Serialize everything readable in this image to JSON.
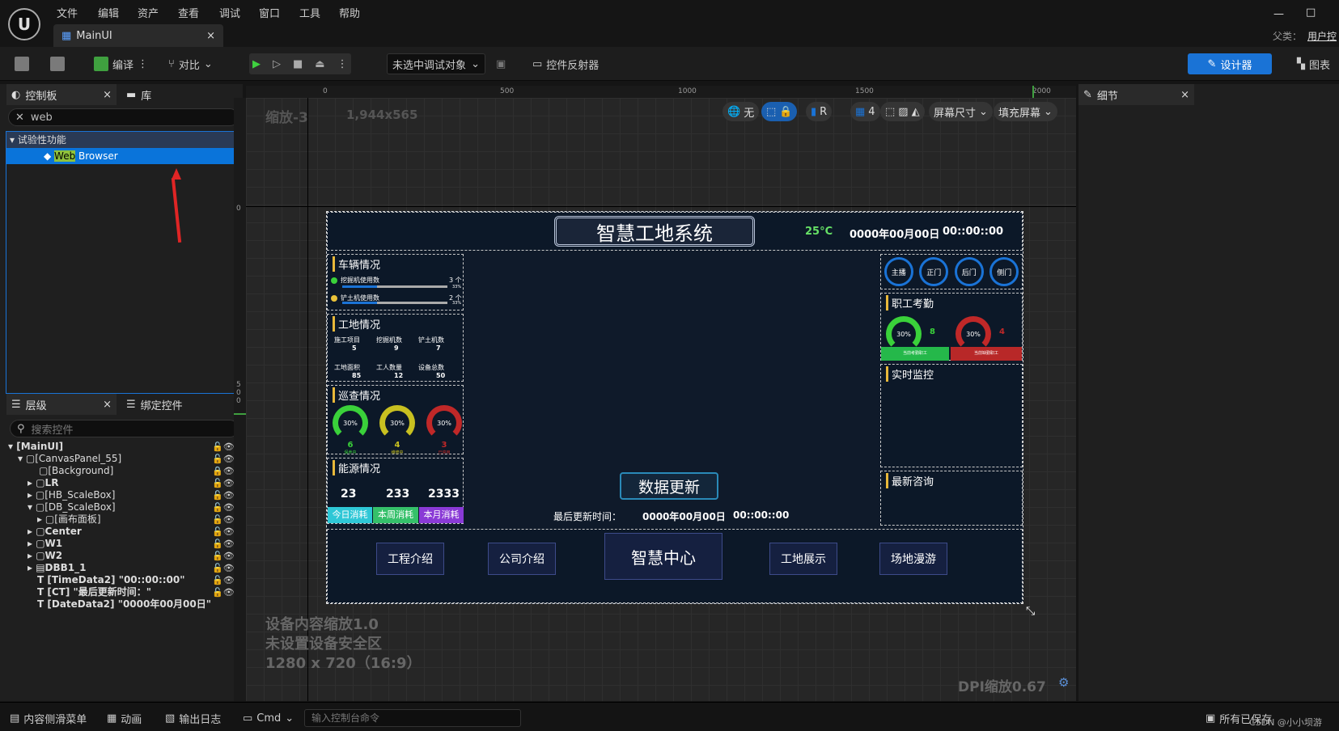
{
  "menu": [
    "文件",
    "编辑",
    "资产",
    "查看",
    "调试",
    "窗口",
    "工具",
    "帮助"
  ],
  "doc_tab": {
    "label": "MainUI"
  },
  "window": {
    "parent_label": "父类：",
    "parent_value": "用户控"
  },
  "toolbar": {
    "compile": "编译",
    "diff": "对比",
    "debug_select": "未选中调试对象",
    "widget_reflector": "控件反射器",
    "designer": "设计器",
    "graph": "图表"
  },
  "palette": {
    "tab": "控制板",
    "library_tab": "库",
    "search_value": "web",
    "category": "试验性功能",
    "item_highlight": "Web",
    "item_rest": " Browser"
  },
  "hierarchy": {
    "tab": "层级",
    "bind_tab": "绑定控件",
    "search_placeholder": "搜索控件",
    "items": [
      "[MainUI]",
      "[CanvasPanel_55]",
      "[Background]",
      "LR",
      "[HB_ScaleBox]",
      "[DB_ScaleBox]",
      "[画布面板]",
      "Center",
      "W1",
      "W2",
      "DBB1_1",
      "[TimeData2] \"00::00::00\"",
      "[CT] \"最后更新时间：\"",
      "[DateData2] \"0000年00月00日\""
    ]
  },
  "details": {
    "tab": "细节"
  },
  "viewport": {
    "zoom": "缩放-3",
    "resolution": "1,944x565",
    "ctrl_none": "无",
    "ctrl_r": "R",
    "ctrl_grid": "4",
    "screen_size": "屏幕尺寸",
    "fill_screen": "填充屏幕",
    "ruler_h": [
      "0",
      "500",
      "1000",
      "1500",
      "2000"
    ],
    "ruler_v_top": "0",
    "ruler_v_mid": "500",
    "info_lines": [
      "设备内容缩放1.0",
      "未设置设备安全区",
      "1280 x 720（16:9）"
    ],
    "dpi": "DPI缩放0.67"
  },
  "dashboard": {
    "title": "智慧工地系统",
    "temp": "25°C",
    "date": "0000年00月00日",
    "time": "00::00::00",
    "vehicle": {
      "title": "车辆情况",
      "rows": [
        {
          "label": "挖掘机使用数",
          "count": "3 个",
          "pct": "33%",
          "fill": 0.33
        },
        {
          "label": "铲土机使用数",
          "count": "2 个",
          "pct": "33%",
          "fill": 0.33
        }
      ]
    },
    "site": {
      "title": "工地情况",
      "items": [
        {
          "label": "施工项目",
          "value": "5"
        },
        {
          "label": "挖掘机数",
          "value": "9"
        },
        {
          "label": "铲土机数",
          "value": "7"
        },
        {
          "label": "工地面积",
          "value": "85"
        },
        {
          "label": "工人数量",
          "value": "12"
        },
        {
          "label": "设备总数",
          "value": "50"
        }
      ]
    },
    "patrol": {
      "title": "巡查情况",
      "gauges": [
        {
          "pct": "30%",
          "value": "6",
          "label": "保养中",
          "color": "#3ad13a"
        },
        {
          "pct": "30%",
          "value": "4",
          "label": "维修中",
          "color": "#c8c020"
        },
        {
          "pct": "30%",
          "value": "3",
          "label": "已停用",
          "color": "#c02828"
        }
      ]
    },
    "energy": {
      "title": "能源情况",
      "values": [
        "23",
        "233",
        "2333"
      ],
      "labels": [
        "今日消耗",
        "本周消耗",
        "本月消耗"
      ]
    },
    "cams": [
      "主播",
      "正门",
      "后门",
      "侧门"
    ],
    "attendance": {
      "title": "职工考勤",
      "left": {
        "pct": "30%",
        "value": "8",
        "bar": "当前考勤职工"
      },
      "right": {
        "pct": "30%",
        "value": "4",
        "bar": "当前缺勤职工"
      }
    },
    "monitor": {
      "title": "实时监控"
    },
    "news": {
      "title": "最新咨询"
    },
    "update": {
      "button": "数据更新",
      "label": "最后更新时间：",
      "date": "0000年00月00日",
      "time": "00::00::00"
    },
    "bottom": [
      "工程介绍",
      "公司介绍",
      "智慧中心",
      "工地展示",
      "场地漫游"
    ]
  },
  "statusbar": {
    "content_drawer": "内容侧滑菜单",
    "animation": "动画",
    "output_log": "输出日志",
    "cmd": "Cmd",
    "cmd_placeholder": "输入控制台命令",
    "saved": "所有已保存",
    "csdn": "CSDN @小小坝游"
  }
}
